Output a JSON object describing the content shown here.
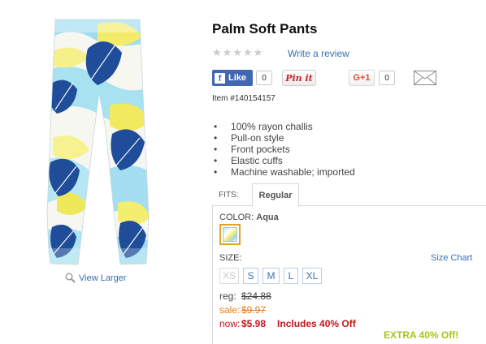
{
  "product": {
    "title": "Palm Soft Pants",
    "write_review": "Write a review",
    "rating": 0,
    "rating_max": 5,
    "item_number": "Item #140154157",
    "view_larger": "View Larger",
    "features": [
      "100% rayon challis",
      "Pull-on style",
      "Front pockets",
      "Elastic cuffs",
      "Machine washable; imported"
    ]
  },
  "social": {
    "like_label": "Like",
    "like_count": "0",
    "pinit_label": "Pin it",
    "gplus_label": "G+1",
    "gplus_count": "0"
  },
  "fits": {
    "label": "FITS:",
    "selected_tab": "Regular"
  },
  "color": {
    "label": "COLOR:",
    "selected": "Aqua",
    "swatch_border": "#e2a227"
  },
  "size": {
    "label": "SIZE:",
    "chart_link": "Size Chart",
    "options": [
      "XS",
      "S",
      "M",
      "L",
      "XL"
    ],
    "disabled": [
      "XS"
    ]
  },
  "pricing": {
    "reg_label": "reg:",
    "reg_value": "$24.88",
    "sale_label": "sale:",
    "sale_value": "$9.97",
    "now_label": "now:",
    "now_value": "$5.98",
    "now_note": "Includes 40% Off",
    "promo": "EXTRA 40% Off!"
  },
  "colors": {
    "link": "#3a6fb5",
    "sale": "#e67c1b",
    "now": "#c3161c",
    "promo": "#a8c31b",
    "facebook": "#4267b2",
    "pinterest": "#cb2027",
    "gplus": "#dd4b39"
  }
}
